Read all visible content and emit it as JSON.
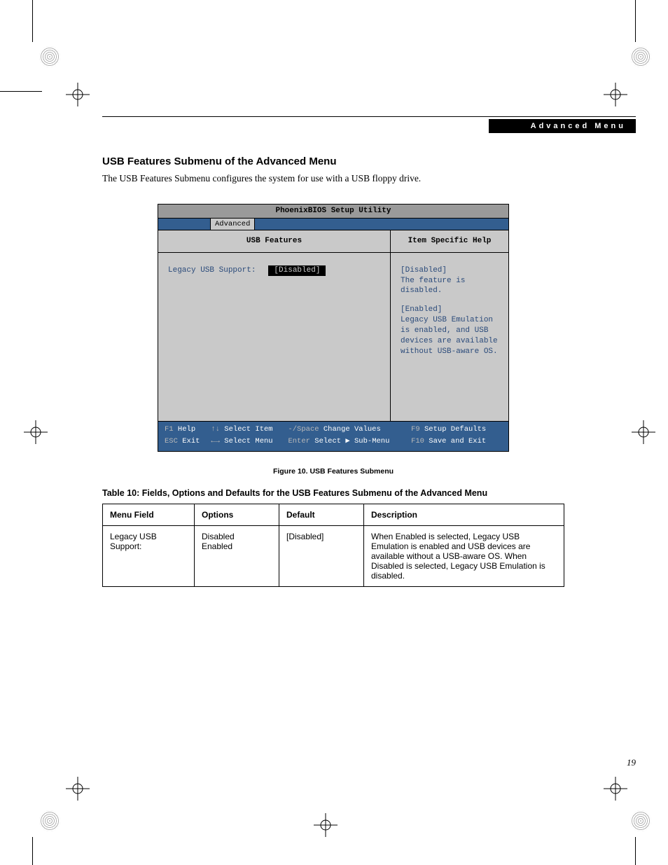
{
  "header": {
    "label": "Advanced Menu"
  },
  "section": {
    "title": "USB Features Submenu of the Advanced Menu",
    "intro": "The USB Features Submenu configures the system for use with a USB floppy drive."
  },
  "bios": {
    "title": "PhoenixBIOS Setup Utility",
    "active_tab": "Advanced",
    "left_header": "USB Features",
    "right_header": "Item Specific Help",
    "field_label": "Legacy USB Support:",
    "field_value": "[Disabled]",
    "help": {
      "h1": "[Disabled]",
      "l1": "The feature is disabled.",
      "h2": "[Enabled]",
      "l2a": "Legacy USB Emulation",
      "l2b": "is enabled, and USB",
      "l2c": "devices are available",
      "l2d": "without USB-aware OS."
    },
    "footer": {
      "r1c1k": "F1",
      "r1c1t": "Help",
      "r1c2k": "↑↓",
      "r1c2t": "Select Item",
      "r1c3k": "-/Space",
      "r1c3t": "Change Values",
      "r1c4k": "F9",
      "r1c4t": "Setup Defaults",
      "r2c1k": "ESC",
      "r2c1t": "Exit",
      "r2c2k": "←→",
      "r2c2t": "Select Menu",
      "r2c3k": "Enter",
      "r2c3t": "Select ▶ Sub-Menu",
      "r2c4k": "F10",
      "r2c4t": "Save and Exit"
    }
  },
  "figure_caption": "Figure 10.  USB Features Submenu",
  "table_caption": "Table 10: Fields, Options and Defaults for the USB Features Submenu of the Advanced Menu",
  "table": {
    "headers": {
      "c1": "Menu Field",
      "c2": "Options",
      "c3": "Default",
      "c4": "Description"
    },
    "row": {
      "field": "Legacy USB Support:",
      "opt1": "Disabled",
      "opt2": "Enabled",
      "def": "[Disabled]",
      "desc": "When Enabled is selected, Legacy USB Emulation is enabled and USB devices are available without a USB-aware OS. When Disabled is selected, Legacy USB Emulation is disabled."
    }
  },
  "page_number": "19"
}
